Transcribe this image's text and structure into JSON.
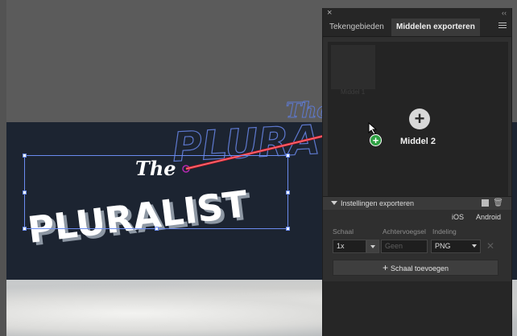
{
  "artwork": {
    "the_text": "The",
    "pluralist_text": "PLURALIST",
    "ghost_the_text": "The",
    "ghost_pluralist_text": "PLURA"
  },
  "panel": {
    "close_icon": "×",
    "collapse_icon": "‹‹",
    "tabs": [
      {
        "label": "Tekengebieden",
        "active": false
      },
      {
        "label": "Middelen exporteren",
        "active": true
      }
    ],
    "assets": {
      "thumb_label": "Middel 1",
      "new_asset_label": "Middel 2",
      "add_icon": "+"
    },
    "export_settings": {
      "label": "Instellingen exporteren",
      "platforms": [
        "iOS",
        "Android"
      ],
      "columns": {
        "scale": "Schaal",
        "suffix": "Achtervoegsel",
        "format": "Indeling"
      },
      "row": {
        "scale": "1x",
        "suffix_placeholder": "Geen",
        "format": "PNG",
        "remove": "✕"
      },
      "add_scale": "Schaal toevoegen",
      "add_scale_icon": "+"
    }
  },
  "cursor": {
    "badge": "+"
  },
  "colors": {
    "arrow": "#e8232f",
    "selection": "#6b8cf0",
    "artboard": "#1c2431",
    "panel": "#2f2f2f",
    "badge": "#2ea043"
  }
}
